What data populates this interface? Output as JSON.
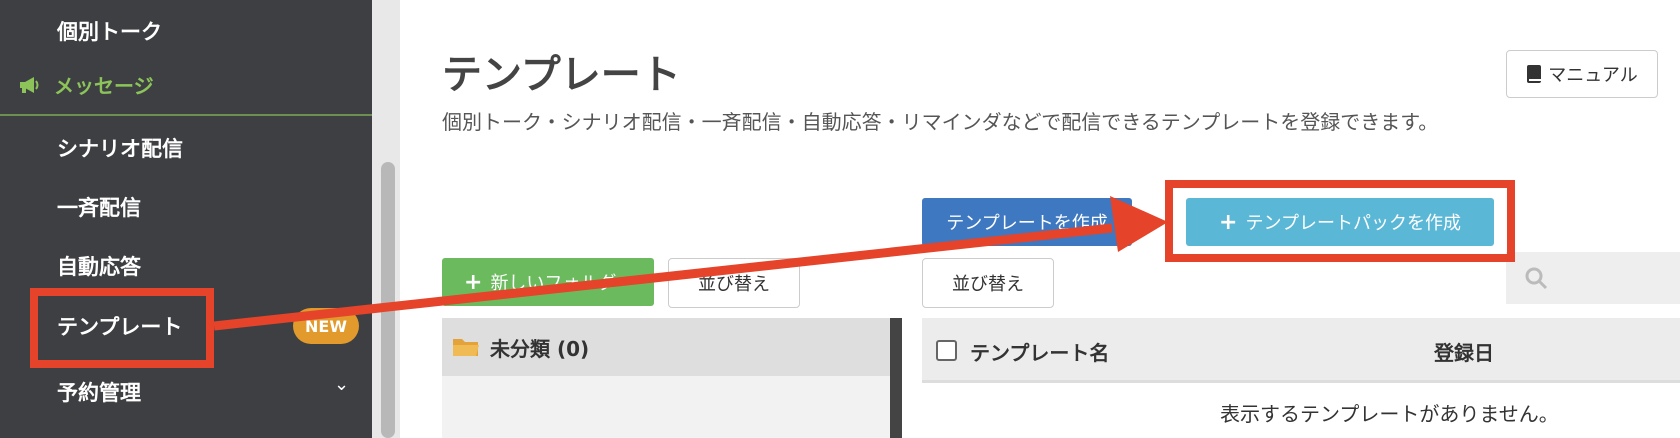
{
  "sidebar": {
    "items": {
      "talk": "個別トーク",
      "message_section": "メッセージ",
      "scenario": "シナリオ配信",
      "broadcast": "一斉配信",
      "auto_reply": "自動応答",
      "template": "テンプレート",
      "reservation": "予約管理"
    },
    "badge": "NEW",
    "chevron": "⌄"
  },
  "header": {
    "title": "テンプレート",
    "subtitle": "個別トーク・シナリオ配信・一斉配信・自動応答・リマインダなどで配信できるテンプレートを登録できます。",
    "manual_button": "マニュアル"
  },
  "toolbar": {
    "create_template": "テンプレートを作成",
    "create_pack": "テンプレートパックを作成",
    "new_folder": "新しいフォルダ",
    "sort_left": "並び替え",
    "sort_right": "並び替え",
    "plus": "+"
  },
  "folders": {
    "unclassified": "未分類 (0)"
  },
  "table": {
    "col_name": "テンプレート名",
    "col_date": "登録日",
    "empty": "表示するテンプレートがありません。"
  },
  "colors": {
    "highlight": "#e5432a",
    "accent_green": "#8cc45a",
    "primary_blue": "#3e78c0",
    "light_blue": "#5bb7d6"
  },
  "icons": [
    "megaphone-icon",
    "book-icon",
    "plus-icon",
    "search-icon",
    "folder-icon",
    "chevron-down-icon"
  ]
}
